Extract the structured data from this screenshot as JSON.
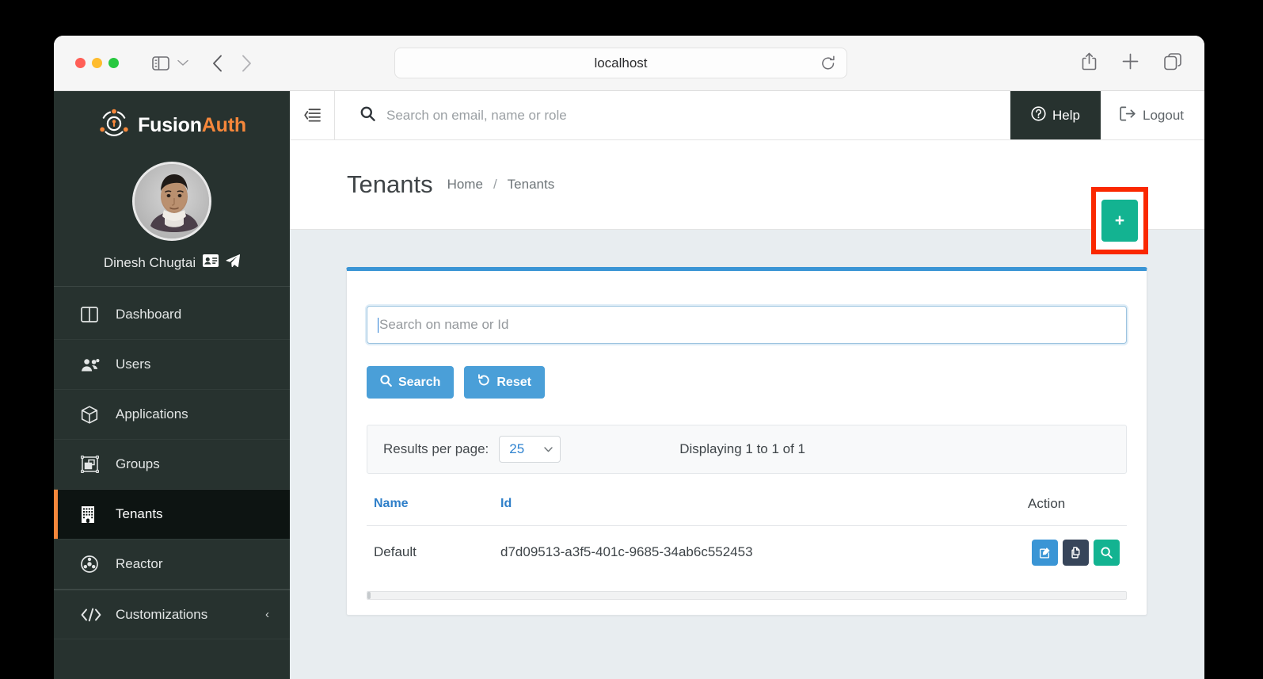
{
  "browser": {
    "url": "localhost",
    "icons": {
      "sidebar_toggle": "sidebar-toggle-icon",
      "chevron_down": "chevron-down-icon",
      "back": "back-arrow-icon",
      "forward": "forward-arrow-icon",
      "reload": "reload-icon",
      "share": "share-icon",
      "new_tab": "plus-icon",
      "tabs_overview": "tabs-overview-icon"
    }
  },
  "sidebar": {
    "brand": {
      "first": "Fusion",
      "second": "Auth"
    },
    "user": {
      "name": "Dinesh Chugtai",
      "badge_icon": "id-card-icon",
      "impersonate_icon": "paper-plane-icon"
    },
    "items": [
      {
        "label": "Dashboard",
        "icon": "dashboard-icon",
        "active": false
      },
      {
        "label": "Users",
        "icon": "users-icon",
        "active": false
      },
      {
        "label": "Applications",
        "icon": "applications-cube-icon",
        "active": false
      },
      {
        "label": "Groups",
        "icon": "groups-icon",
        "active": false
      },
      {
        "label": "Tenants",
        "icon": "tenants-building-icon",
        "active": true
      },
      {
        "label": "Reactor",
        "icon": "reactor-icon",
        "active": false
      },
      {
        "label": "Customizations",
        "icon": "code-brackets-icon",
        "active": false,
        "chevron": "‹"
      }
    ]
  },
  "topbar": {
    "collapse_icon": "collapse-menu-icon",
    "search_placeholder": "Search on email, name or role",
    "search_value": "",
    "help_label": "Help",
    "logout_label": "Logout"
  },
  "page": {
    "title": "Tenants",
    "breadcrumb": [
      "Home",
      "Tenants"
    ],
    "breadcrumb_separator": "/",
    "add_button_label": "+"
  },
  "search_panel": {
    "placeholder": "Search on name or Id",
    "value": "",
    "search_label": "Search",
    "reset_label": "Reset"
  },
  "results": {
    "per_page_label": "Results per page:",
    "per_page_value": "25",
    "displaying_text": "Displaying 1 to 1 of 1"
  },
  "table": {
    "columns": [
      "Name",
      "Id",
      "Action"
    ],
    "rows": [
      {
        "name": "Default",
        "id": "d7d09513-a3f5-401c-9685-34ab6c552453",
        "actions": [
          "edit-icon",
          "duplicate-icon",
          "view-search-icon"
        ]
      }
    ]
  },
  "colors": {
    "sidebar_bg": "#27322f",
    "accent_orange": "#f5873b",
    "card_top_border": "#3a95d5",
    "primary_blue": "#4a9fd8",
    "green": "#13b391",
    "highlight_red": "#fa2800",
    "content_bg": "#e8edf0"
  }
}
